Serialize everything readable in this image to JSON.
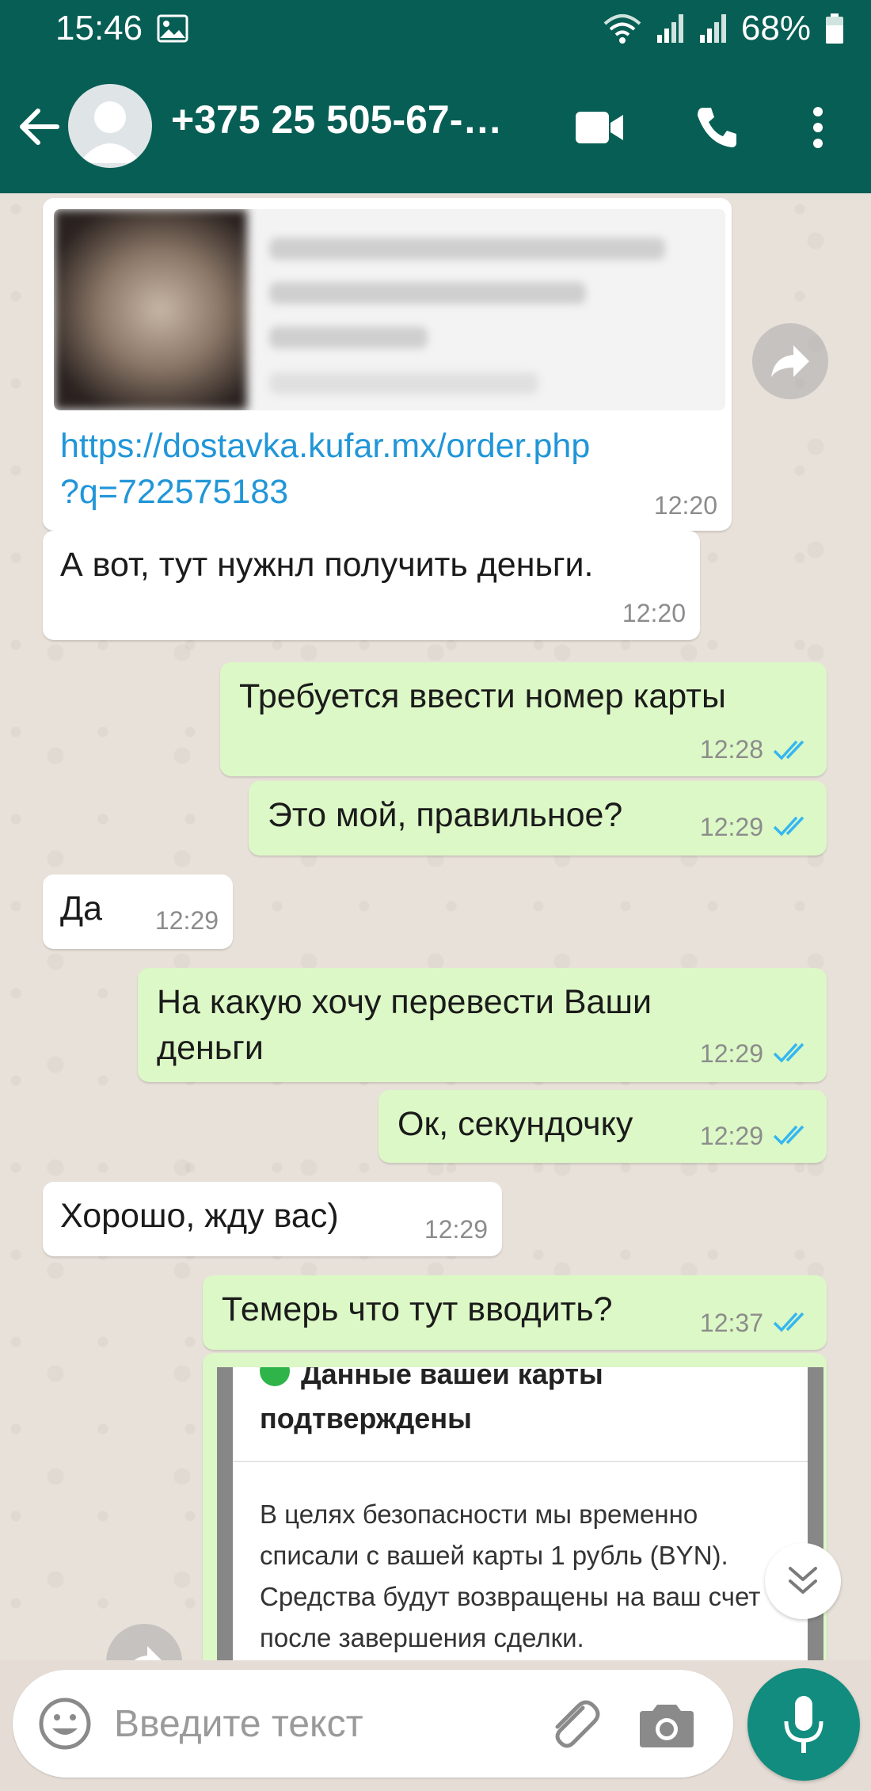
{
  "status_bar": {
    "time": "15:46",
    "battery": "68%"
  },
  "header": {
    "contact_name": "+375 25 505-67-…"
  },
  "messages": [
    {
      "link_line1": "https://dostavka.kufar.mx/order.php",
      "link_line2": "?q=722575183",
      "time": "12:20"
    },
    {
      "text": "А вот, тут нужнл получить деньги.",
      "time": "12:20"
    },
    {
      "text": "Требуется ввести номер карты",
      "time": "12:28"
    },
    {
      "text": "Это мой, правильное?",
      "time": "12:29"
    },
    {
      "text": "Да",
      "time": "12:29"
    },
    {
      "text_line1": "На какую хочу перевести Ваши",
      "text_line2": "деньги",
      "time": "12:29"
    },
    {
      "text": "Ок, секундочку",
      "time": "12:29"
    },
    {
      "text": "Хорошо, жду вас)",
      "time": "12:29"
    },
    {
      "text": "Темерь что тут вводить?",
      "time": "12:37"
    }
  ],
  "screenshot_message": {
    "title_cut": "Данные вашей карты",
    "title": "подтверждены",
    "body": "В целях безопасности мы временно списали с вашей карты 1 рубль (BYN). Средства будут возвращены на ваш счет после завершения сделки."
  },
  "composer": {
    "placeholder": "Введите текст"
  },
  "colors": {
    "header": "#075e54",
    "outgoing_bubble": "#dcf8c6",
    "incoming_bubble": "#ffffff",
    "read_ticks": "#34b7f1",
    "link": "#2196d8",
    "mic_button": "#128c7e"
  },
  "icons": [
    "image-icon",
    "wifi-icon",
    "signal-icon",
    "battery-icon",
    "back-arrow-icon",
    "avatar-icon",
    "video-call-icon",
    "phone-icon",
    "more-vert-icon",
    "forward-icon",
    "read-ticks-icon",
    "double-chevron-down-icon",
    "emoji-icon",
    "attach-icon",
    "camera-icon",
    "mic-icon"
  ]
}
